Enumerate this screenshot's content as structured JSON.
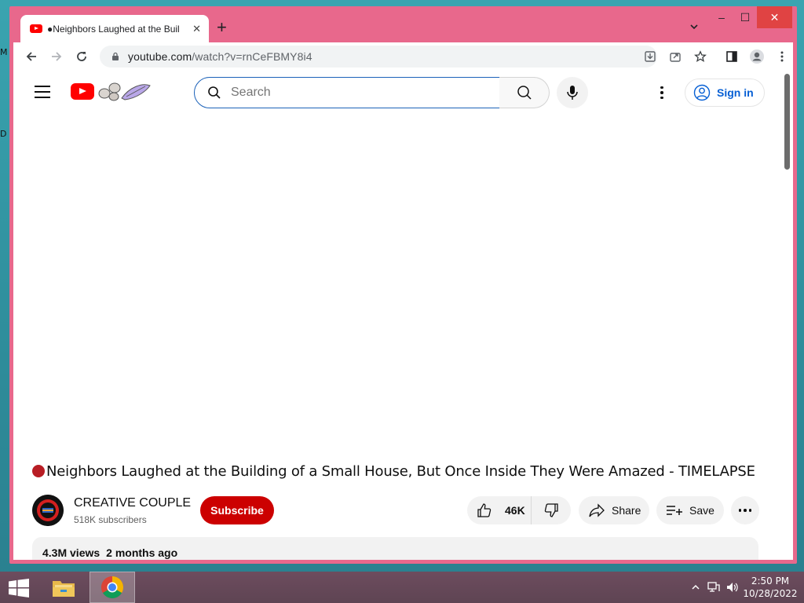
{
  "desktop": {
    "edge_letters": [
      "M",
      "D"
    ]
  },
  "browser": {
    "tab": {
      "title": "●Neighbors Laughed at the Buil"
    },
    "window_controls": {
      "minimize": "–",
      "maximize": "☐",
      "close": "✕"
    },
    "omnibox": {
      "url_host": "youtube.com",
      "url_path": "/watch?v=rnCeFBMY8i4"
    }
  },
  "youtube": {
    "search": {
      "placeholder": "Search"
    },
    "sign_in_label": "Sign in",
    "video": {
      "title": "Neighbors Laughed at the Building of a Small House, But Once Inside They Were Amazed - TIMELAPSE",
      "channel": "CREATIVE COUPLE",
      "subscribers": "518K subscribers",
      "subscribe_label": "Subscribe",
      "likes": "46K",
      "share_label": "Share",
      "save_label": "Save",
      "views": "4.3M views",
      "age": "2 months ago"
    }
  },
  "taskbar": {
    "time": "2:50 PM",
    "date": "10/28/2022"
  },
  "colors": {
    "window_frame": "#e8688c",
    "youtube_red": "#ff0000",
    "subscribe_bg": "#cc0000",
    "link_blue": "#065fd4"
  },
  "icons": [
    "youtube-favicon",
    "tab-close-icon",
    "new-tab-icon",
    "back-icon",
    "forward-icon",
    "reload-icon",
    "lock-icon",
    "install-icon",
    "share-page-icon",
    "bookmark-star-icon",
    "side-panel-icon",
    "profile-icon",
    "chrome-menu-icon",
    "hamburger-icon",
    "search-icon",
    "mic-icon",
    "kebab-icon",
    "account-icon",
    "thumbs-up-icon",
    "thumbs-down-icon",
    "share-arrow-icon",
    "playlist-add-icon",
    "windows-start-icon",
    "file-explorer-icon",
    "chrome-icon",
    "tray-chevron-icon",
    "network-icon",
    "volume-icon"
  ]
}
